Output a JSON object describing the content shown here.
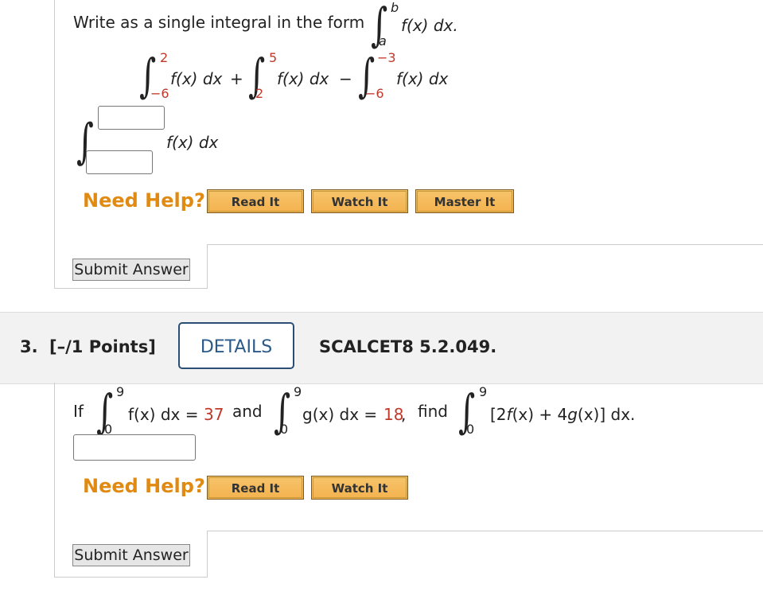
{
  "q2": {
    "prompt": "Write as a single integral in the form",
    "form": {
      "lower": "a",
      "upper": "b",
      "integrand": "f(x) dx."
    },
    "expression": {
      "t1": {
        "lower": "−6",
        "upper": "2",
        "integrand": "f(x) dx"
      },
      "op1": "+",
      "t2": {
        "lower": "2",
        "upper": "5",
        "integrand": "f(x) dx"
      },
      "op2": "−",
      "t3": {
        "lower": "−6",
        "upper": "−3",
        "integrand": "f(x) dx"
      }
    },
    "answer": {
      "integrand": "f(x) dx",
      "upper_value": "",
      "lower_value": ""
    },
    "need_help": "Need Help?",
    "buttons": {
      "read": "Read It",
      "watch": "Watch It",
      "master": "Master It"
    },
    "submit": "Submit Answer"
  },
  "q3": {
    "number": "3.",
    "points": "[–/1 Points]",
    "details": "DETAILS",
    "code": "SCALCET8 5.2.049.",
    "if": "If",
    "i1": {
      "lower": "0",
      "upper": "9",
      "integrand": "f(x) dx =",
      "value": "37"
    },
    "and": "and",
    "i2": {
      "lower": "0",
      "upper": "9",
      "integrand": "g(x) dx =",
      "value": "18",
      "comma": ","
    },
    "find": "find",
    "i3": {
      "lower": "0",
      "upper": "9",
      "integrand_a": "[2",
      "fx": "f",
      "integrand_b": "(x) + 4",
      "gx": "g",
      "integrand_c": "(x)] dx."
    },
    "answer_value": "",
    "need_help": "Need Help?",
    "buttons": {
      "read": "Read It",
      "watch": "Watch It"
    },
    "submit": "Submit Answer"
  }
}
